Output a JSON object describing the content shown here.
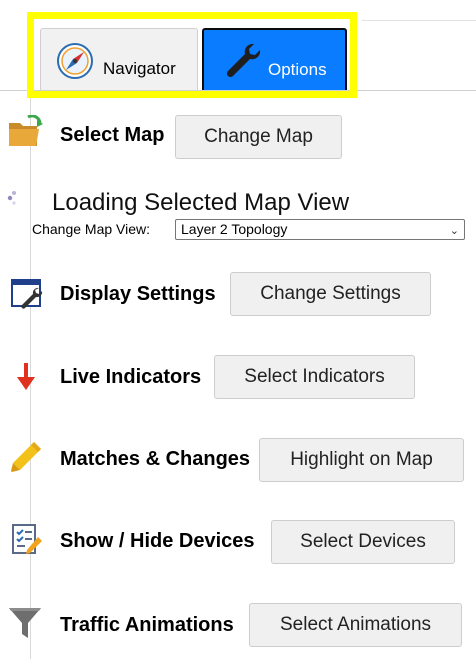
{
  "tabs": {
    "navigator_label": "Navigator",
    "options_label": "Options"
  },
  "rows": {
    "select_map": {
      "label": "Select Map",
      "button": "Change Map"
    },
    "loading": {
      "text": "Loading Selected Map View"
    },
    "map_view": {
      "label": "Change Map View:",
      "selected": "Layer 2 Topology"
    },
    "display_settings": {
      "label": "Display Settings",
      "button": "Change Settings"
    },
    "live_indicators": {
      "label": "Live Indicators",
      "button": "Select Indicators"
    },
    "matches_changes": {
      "label": "Matches & Changes",
      "button": "Highlight on Map"
    },
    "show_hide_devices": {
      "label": "Show / Hide Devices",
      "button": "Select Devices"
    },
    "traffic_animations": {
      "label": "Traffic Animations",
      "button": "Select Animations"
    }
  },
  "icons": {
    "navigator": "compass-icon",
    "options": "wrench-icon",
    "select_map": "folder-icon",
    "display_settings": "settings-window-icon",
    "live_indicators": "down-arrow-icon",
    "matches_changes": "highlighter-icon",
    "show_hide_devices": "checklist-icon",
    "traffic_animations": "funnel-icon",
    "loading": "spinner-icon"
  },
  "colors": {
    "highlight": "#ffff00",
    "options_tab": "#0a7cff",
    "arrow": "#e0301e",
    "highlighter": "#f2c21b"
  }
}
